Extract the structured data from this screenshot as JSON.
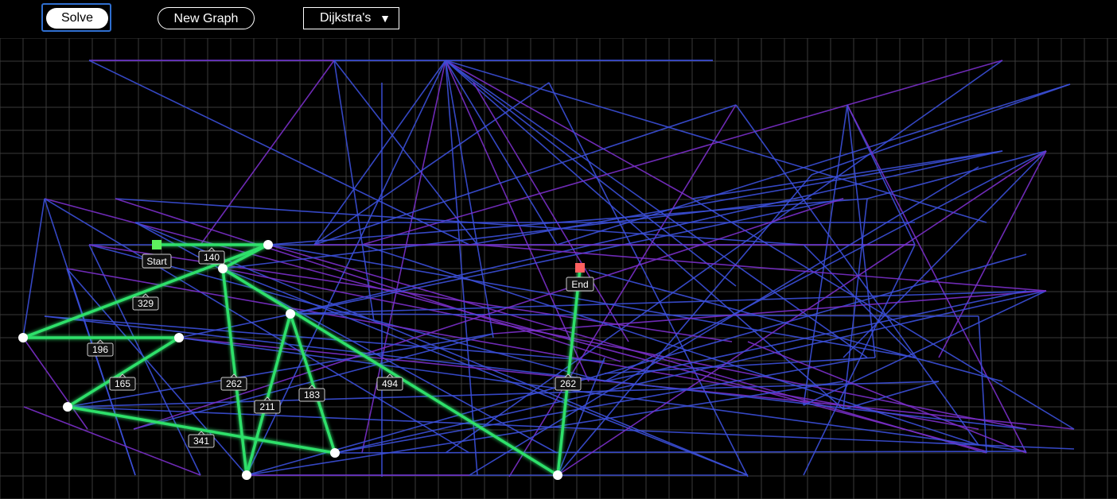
{
  "toolbar": {
    "solve_label": "Solve",
    "new_graph_label": "New Graph",
    "algorithm": "Dijkstra's",
    "dropdown_arrow": "▼"
  },
  "markers": {
    "start_label": "Start",
    "end_label": "End"
  },
  "path_weights": [
    "140",
    "329",
    "196",
    "165",
    "262",
    "211",
    "183",
    "494",
    "262",
    "341"
  ],
  "colors": {
    "background": "#000000",
    "grid": "#3a3a3a",
    "edge_blue": "#3b4fd8",
    "edge_purple": "#7a2fc9",
    "path": "#2ee06a",
    "start": "#5ef05e",
    "end": "#ff6060"
  }
}
